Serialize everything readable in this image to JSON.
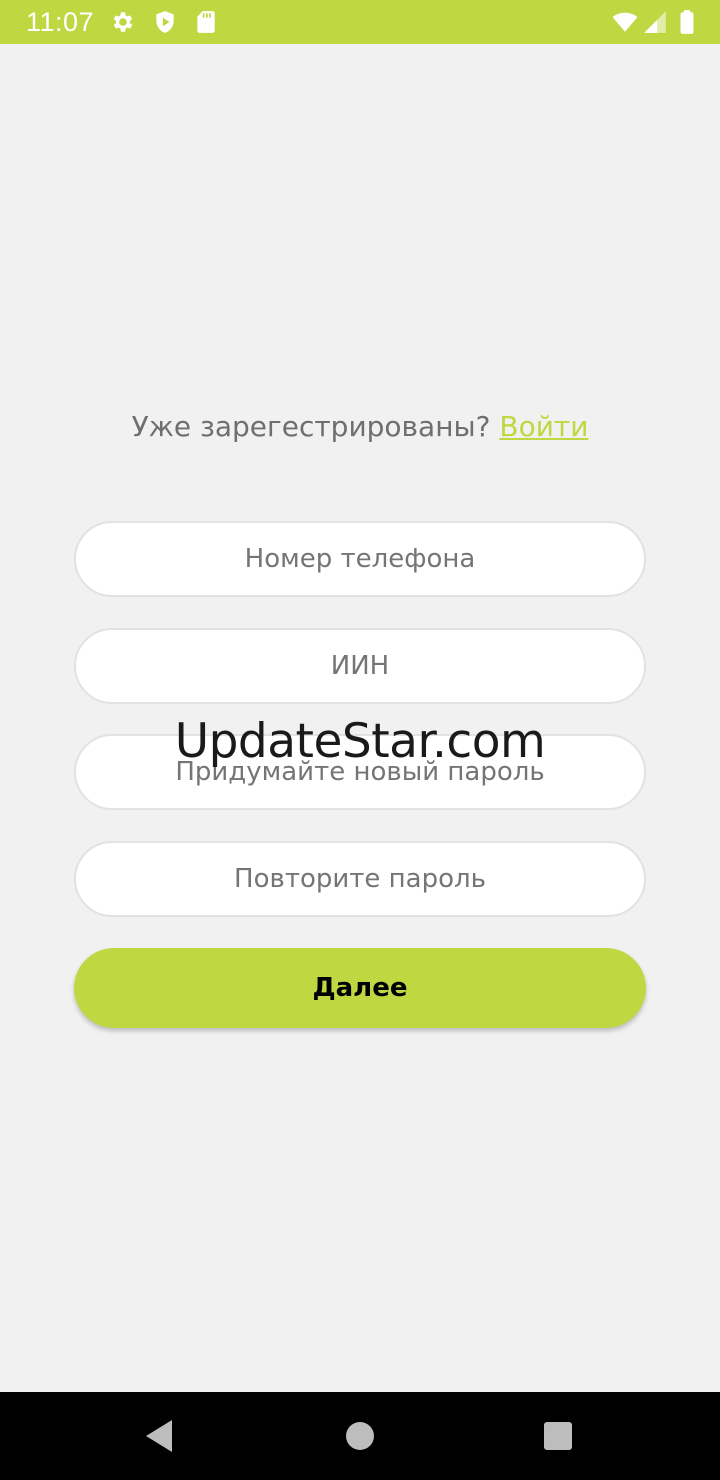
{
  "status_bar": {
    "time": "11:07",
    "bg_color": "#bfd740",
    "left_icons": [
      "settings-gear-icon",
      "shield-play-icon",
      "sd-card-icon"
    ],
    "right_icons": [
      "wifi-icon",
      "cell-signal-icon",
      "battery-icon"
    ]
  },
  "login_prompt": {
    "text": "Уже зарегестрированы? ",
    "link_label": "Войти",
    "link_color": "#bfd740"
  },
  "form": {
    "phone_placeholder": "Номер телефона",
    "iin_placeholder": "ИИН",
    "new_password_placeholder": "Придумайте новый пароль",
    "repeat_password_placeholder": "Повторите пароль",
    "next_label": "Далее",
    "accent_color": "#bfd740"
  },
  "watermark": {
    "text": "UpdateStar.com"
  },
  "nav_bar": {
    "icons": [
      "back-icon",
      "home-icon",
      "recents-icon"
    ]
  }
}
